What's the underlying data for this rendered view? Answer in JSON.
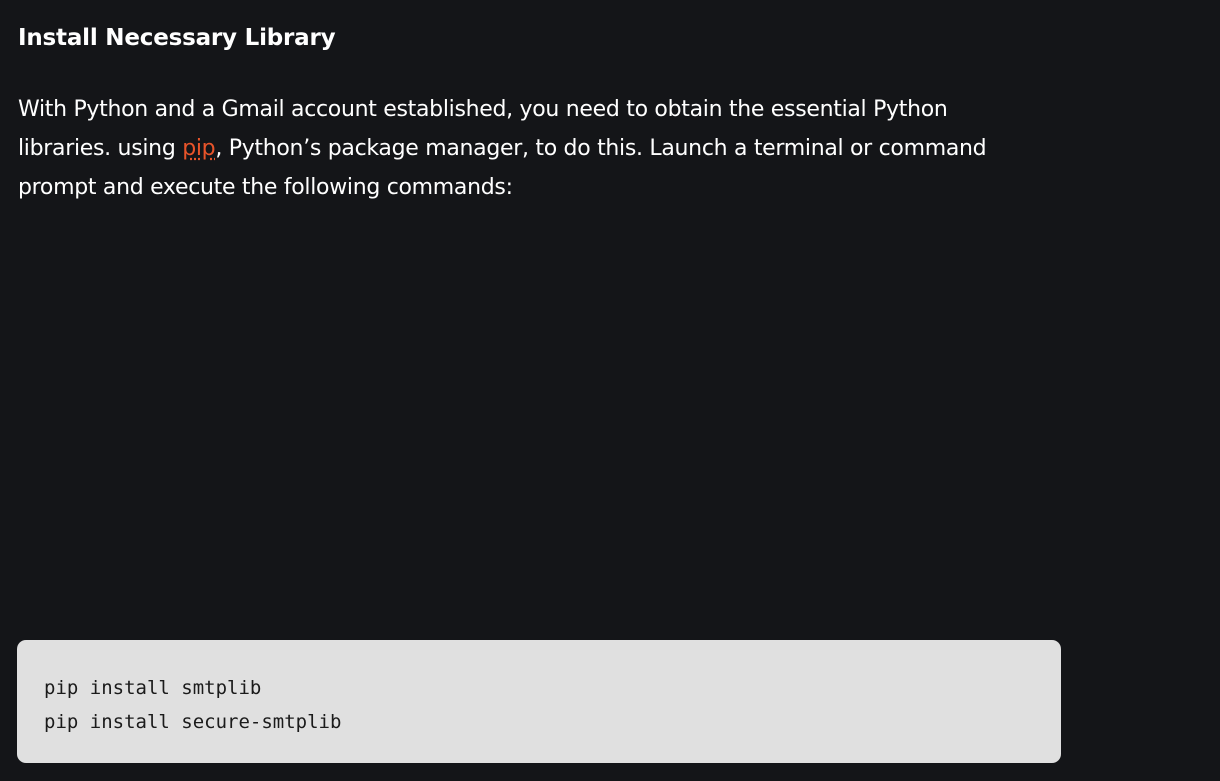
{
  "article": {
    "heading": "Install Necessary Library",
    "paragraph": {
      "line1": "With Python and a Gmail account established, you need to obtain the essential Python",
      "line2_prefix": "libraries. using ",
      "link_text": "pip",
      "line2_suffix": ", Python’s package manager, to do this. Launch a terminal or command",
      "line3": "prompt and execute the following commands:"
    },
    "code": {
      "lines": [
        "pip install smtplib",
        "pip install secure-smtplib"
      ]
    }
  },
  "colors": {
    "background": "#141518",
    "text": "#ffffff",
    "link": "#e8542a",
    "code_background": "#e0e0e0",
    "code_text": "#1b1b1b"
  }
}
